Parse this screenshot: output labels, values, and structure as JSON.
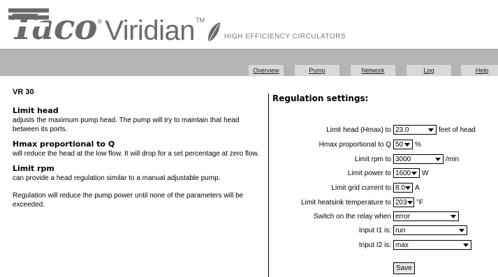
{
  "brand": {
    "name": "Taco",
    "registered": "®",
    "product": "Viridian",
    "trademark": "TM",
    "tagline": "HIGH EFFICIENCY CIRCULATORS",
    "gray": "#6a6a6a"
  },
  "nav": {
    "tabs": [
      {
        "label": "Overview"
      },
      {
        "label": "Pump"
      },
      {
        "label": "Network"
      },
      {
        "label": "Log"
      },
      {
        "label": "Help"
      }
    ],
    "bar_color": "#b4b4b4"
  },
  "left": {
    "model": "VR 30",
    "sections": [
      {
        "title": "Limit head",
        "body": "adjusts the maximum pump head. The pump will try to maintain that head between its ports."
      },
      {
        "title": "Hmax proportional to Q",
        "body": "will reduce the head at the low flow. It will drop for a set percentage at zero flow."
      },
      {
        "title": "Limit rpm",
        "body": "can provide a head regulation similar to a manual adjustable pump."
      }
    ],
    "note": "Regulation will reduce the pump power until none of the parameters will be exceeded."
  },
  "regulation": {
    "title": "Regulation settings:",
    "rows": [
      {
        "label": "Limit head (Hmax) to",
        "value": "23.0",
        "unit": "feet of head"
      },
      {
        "label": "Hmax proportional to Q",
        "value": "50",
        "unit": "%"
      },
      {
        "label": "Limit rpm to",
        "value": "3000",
        "unit": "/min"
      },
      {
        "label": "Limit power to",
        "value": "1600",
        "unit": "W"
      },
      {
        "label": "Limit grid current to",
        "value": "8.0",
        "unit": "A"
      },
      {
        "label": "Limit heatsink temperature to",
        "value": "203",
        "unit": "°F"
      },
      {
        "label": "Switch on the relay when",
        "value": "error",
        "unit": ""
      },
      {
        "label": "Input I1 is:",
        "value": "run",
        "unit": ""
      },
      {
        "label": "Input I2 is:",
        "value": "max",
        "unit": ""
      }
    ],
    "save_label": "Save"
  }
}
